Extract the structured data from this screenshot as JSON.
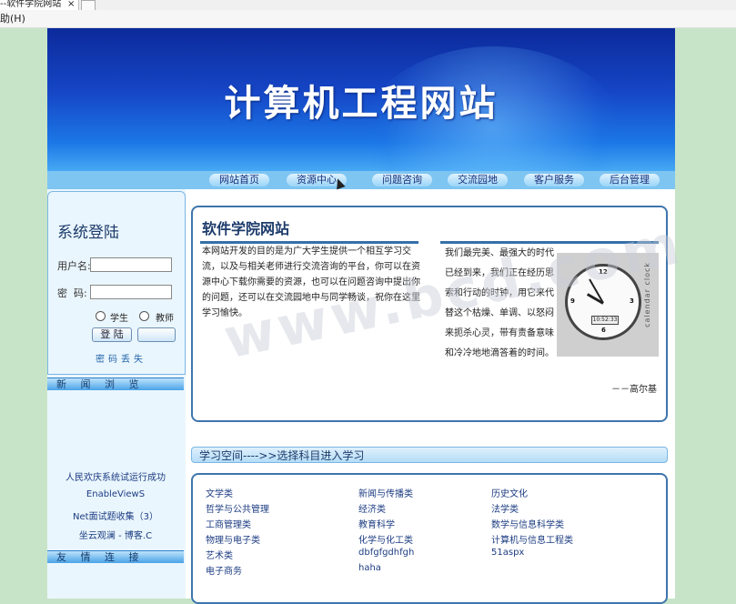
{
  "browser": {
    "tab_title": "--软件学院网站",
    "tab_close": "×",
    "menu_help": "助(H)"
  },
  "banner": {
    "title": "计算机工程网站"
  },
  "nav": [
    {
      "label": "网站首页"
    },
    {
      "label": "资源中心"
    },
    {
      "label": "问题咨询"
    },
    {
      "label": "交流园地"
    },
    {
      "label": "客户服务"
    },
    {
      "label": "后台管理"
    }
  ],
  "login": {
    "title": "系统登陆",
    "username_label": "用户名:",
    "password_label": "密  码:",
    "role_student": "学生",
    "role_teacher": "教师",
    "login_button": "登 陆",
    "forgot_link": "密码丢失"
  },
  "news": {
    "heading": "新 闻 浏 览",
    "items": [
      {
        "text": "人民欢庆系统试运行成功"
      },
      {
        "text": "EnableViewS"
      },
      {
        "text": "Net面试题收集（3）"
      },
      {
        "text": "坐云观澜 - 博客.C"
      }
    ]
  },
  "links": {
    "heading": "友 情 连 接"
  },
  "intro": {
    "title": "软件学院网站",
    "text": "本网站开发的目的是为广大学生提供一个相互学习交流，以及与相关老师进行交流咨询的平台，你可以在资源中心下载你需要的资源，也可以在问题咨询中提出你的问题，还可以在交流园地中与同学畅谈，祝你在这里学习愉快。",
    "quote": "我们最完美、最强大的时代已经到来，我们正在经历思索和行动的时钟，用它来代替这个枯燥、单调、以怒闷来扼杀心灵，带有责备意味和冷冷地地滴答着的时间。",
    "author": "－－高尔基",
    "clock_brand": "calendar clock",
    "clock_time": "10:52:33"
  },
  "learning": {
    "bar_label": "学习空间---->>选择科目进入学习",
    "subjects": [
      [
        "文学类",
        "新闻与传播类",
        "历史文化"
      ],
      [
        "哲学与公共管理",
        "经济类",
        "法学类"
      ],
      [
        "工商管理类",
        "教育科学",
        "数学与信息科学类"
      ],
      [
        "物理与电子类",
        "化学与化工类",
        "计算机与信息工程类"
      ],
      [
        "艺术类",
        "dbfgfgdhfgh",
        "51aspx"
      ],
      [
        "电子商务",
        "haha",
        ""
      ]
    ]
  },
  "watermark": "www.bcd.com",
  "colors": {
    "page_bg": "#c8e4c8",
    "banner_dark": "#0b2a9b",
    "accent_border": "#3e75ac",
    "nav_bg": "#7ec5f2"
  }
}
